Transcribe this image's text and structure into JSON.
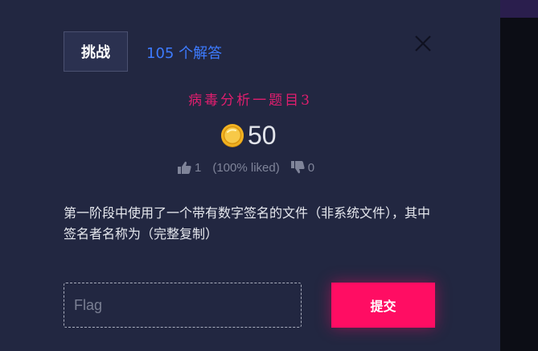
{
  "tabs": {
    "challenge_label": "挑战",
    "solves_label": "105 个解答"
  },
  "challenge": {
    "title": "病毒分析一题目3",
    "points": "50",
    "likes_count": "1",
    "liked_percent": "(100% liked)",
    "dislikes_count": "0",
    "description": "第一阶段中使用了一个带有数字签名的文件（非系统文件），其中签名者名称为（完整复制）"
  },
  "flag_form": {
    "placeholder": "Flag",
    "value": "",
    "submit_label": "提交"
  },
  "icons": {
    "close": "close-icon",
    "coin": "coin-icon",
    "thumbs_up": "thumbs-up-icon",
    "thumbs_down": "thumbs-down-icon"
  },
  "colors": {
    "accent": "#ff0d63",
    "link": "#3d7bff",
    "title": "#e01e6e",
    "modal_bg": "#222741"
  }
}
